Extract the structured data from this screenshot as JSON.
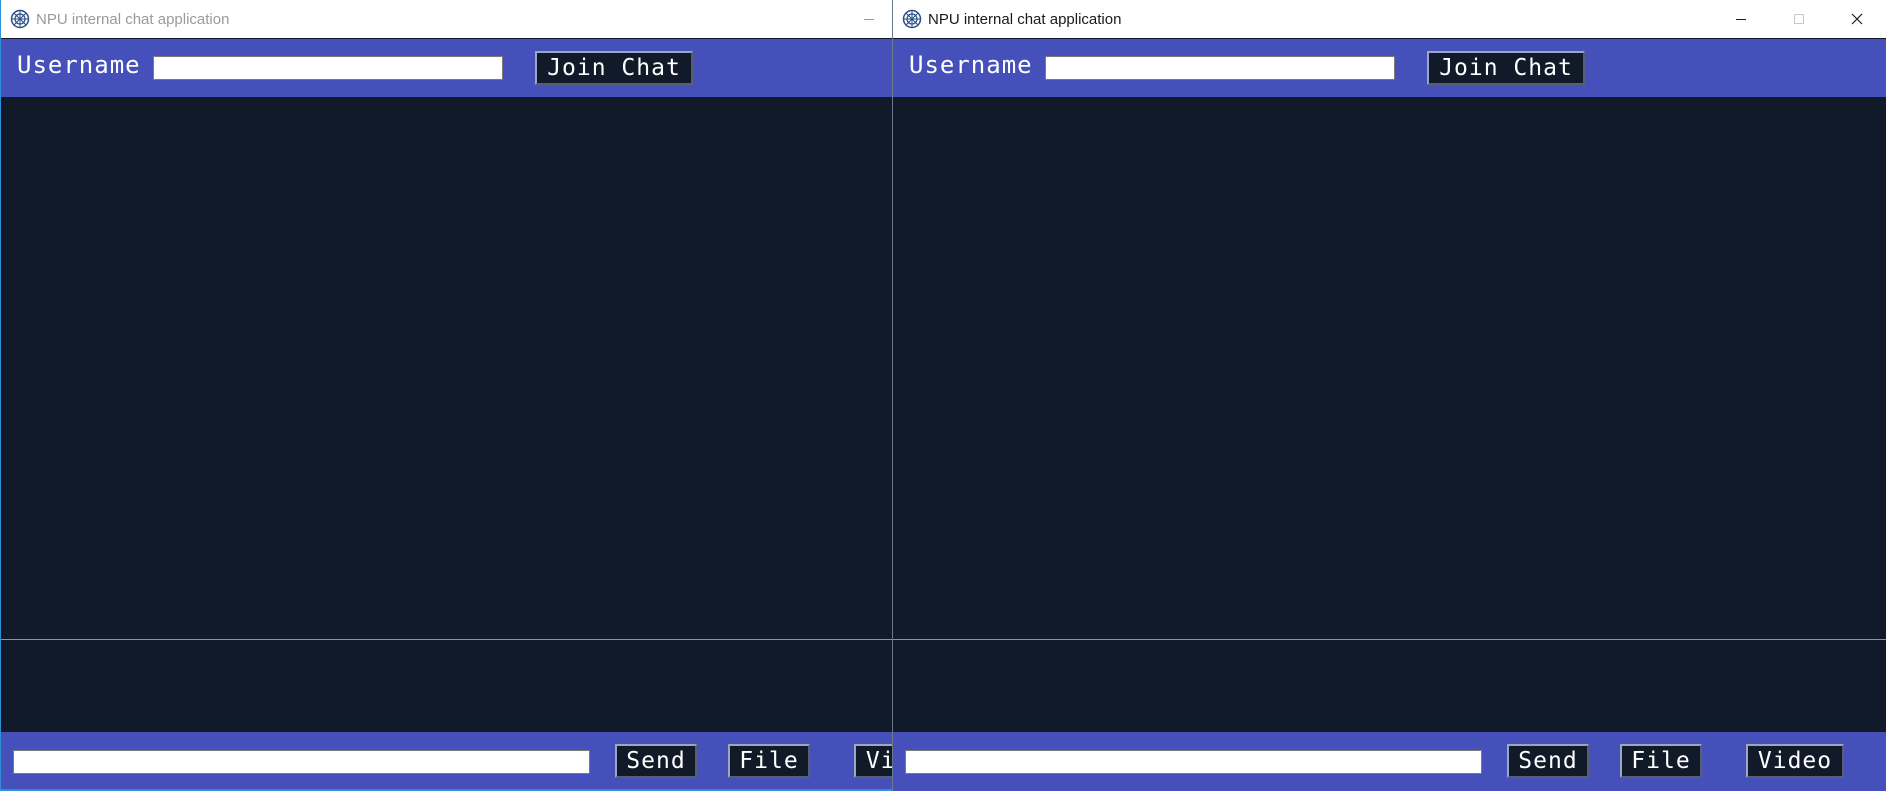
{
  "windows": {
    "left": {
      "title": "NPU internal chat application",
      "app_icon": "npu-logo-icon",
      "window_buttons": [
        "minimize-icon"
      ],
      "header": {
        "username_label": "Username",
        "username_value": "",
        "join_label": "Join Chat"
      },
      "footer": {
        "message_value": "",
        "send_label": "Send",
        "file_label": "File",
        "video_label": "Video"
      }
    },
    "right": {
      "title": "NPU internal chat application",
      "app_icon": "npu-logo-icon",
      "window_buttons": [
        "minimize-icon",
        "maximize-icon",
        "close-icon"
      ],
      "header": {
        "username_label": "Username",
        "username_value": "",
        "join_label": "Join Chat"
      },
      "footer": {
        "message_value": "",
        "send_label": "Send",
        "file_label": "File",
        "video_label": "Video"
      }
    }
  },
  "colors": {
    "bar": "#4650bb",
    "panel": "#101a28",
    "button_bg": "#101a28",
    "button_text": "#ffffff"
  }
}
